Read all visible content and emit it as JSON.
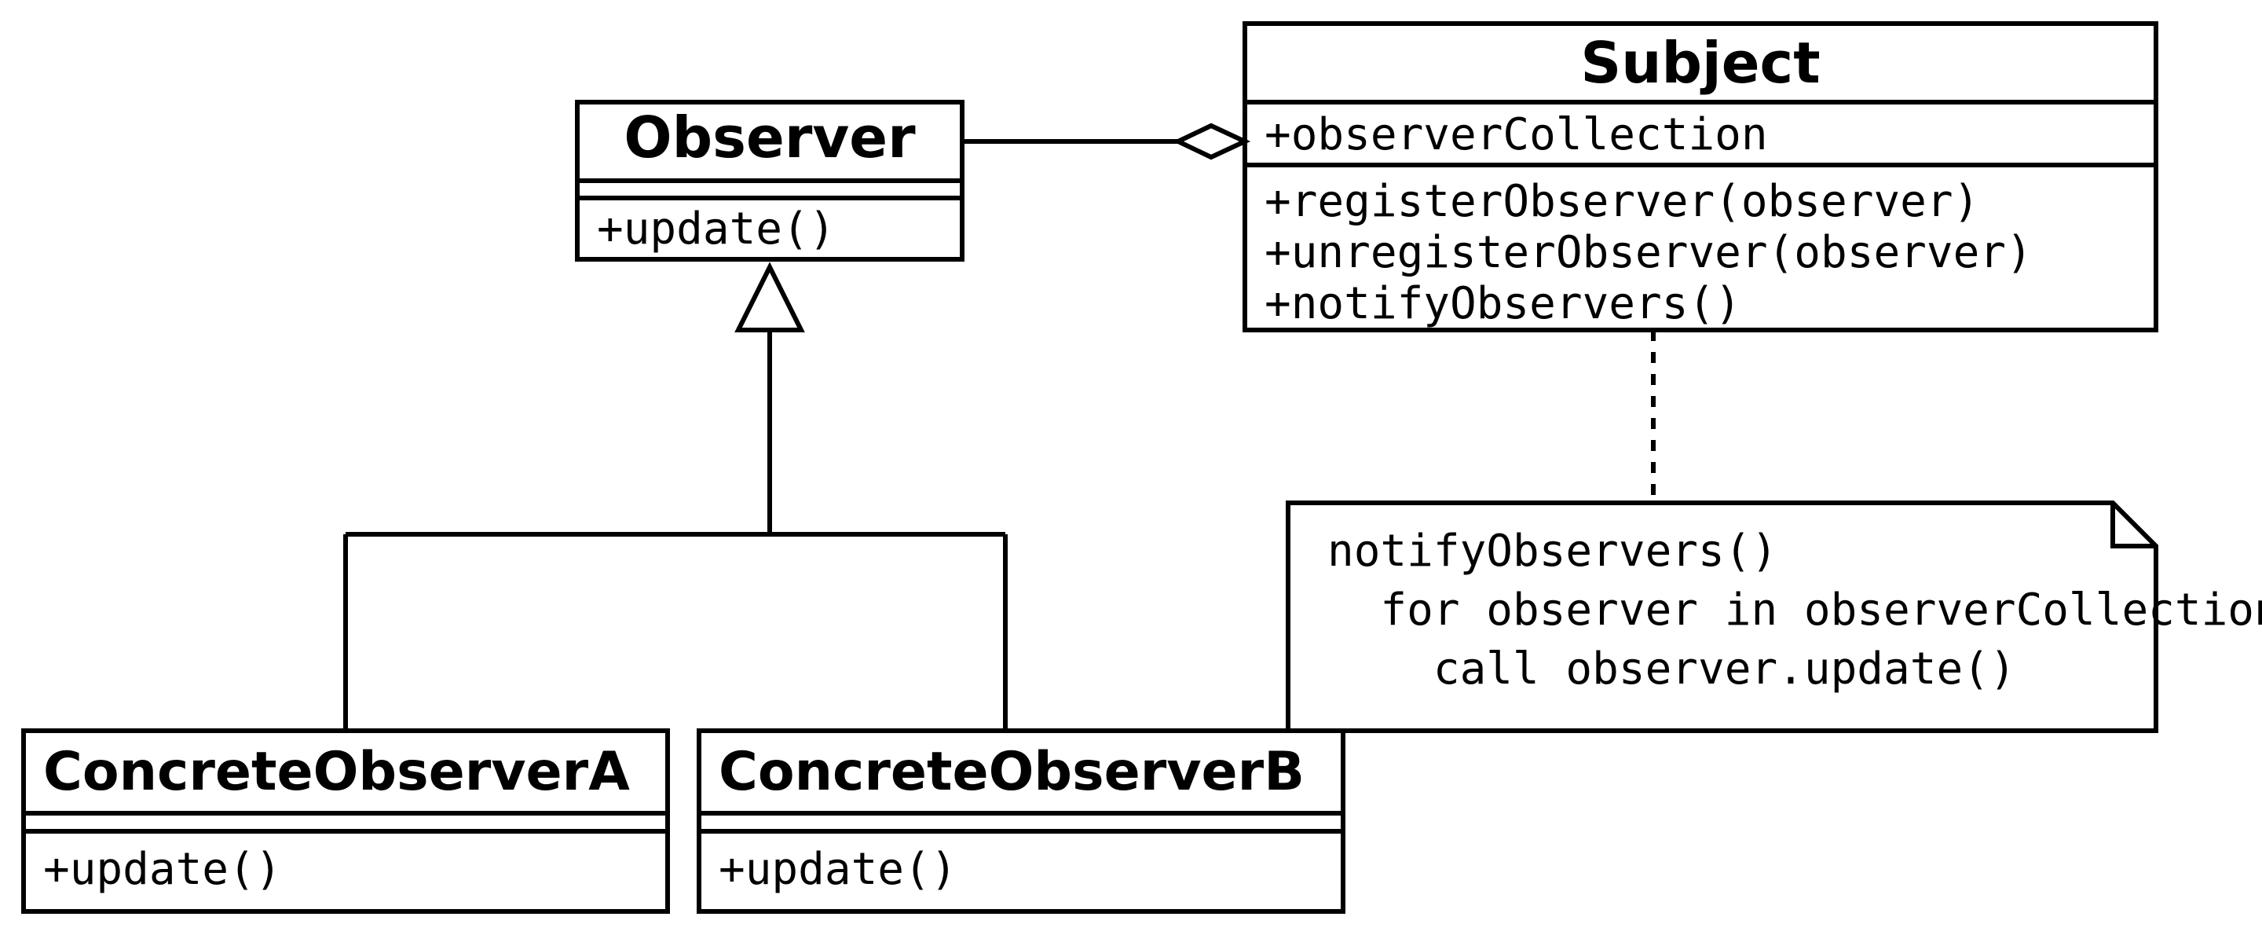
{
  "classes": {
    "observer": {
      "name": "Observer",
      "methods": [
        "+update()"
      ]
    },
    "subject": {
      "name": "Subject",
      "attributes": [
        "+observerCollection"
      ],
      "methods": [
        "+registerObserver(observer)",
        "+unregisterObserver(observer)",
        "+notifyObservers()"
      ]
    },
    "concreteA": {
      "name": "ConcreteObserverA",
      "methods": [
        "+update()"
      ]
    },
    "concreteB": {
      "name": "ConcreteObserverB",
      "methods": [
        "+update()"
      ]
    }
  },
  "note": {
    "lines": [
      "notifyObservers()",
      "  for observer in observerCollection",
      "    call observer.update()"
    ]
  },
  "relations": {
    "aggregation": "Subject ◇— Observer",
    "generalization": [
      "ConcreteObserverA → Observer",
      "ConcreteObserverB → Observer"
    ],
    "dependency": "Subject ···· note"
  }
}
